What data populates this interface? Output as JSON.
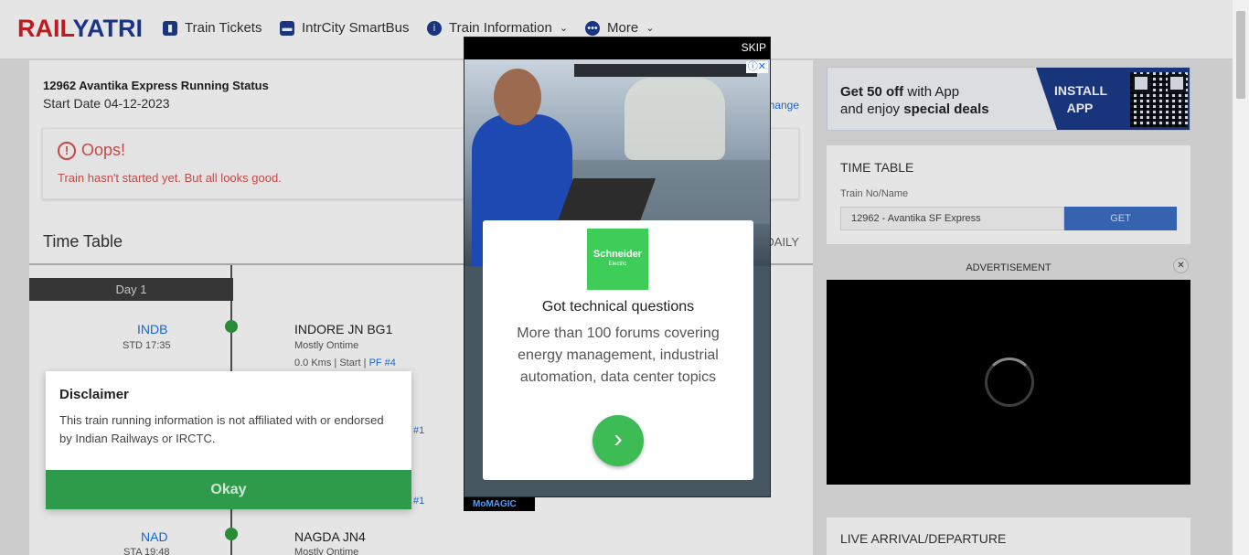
{
  "header": {
    "logo_rail": "RAIL",
    "logo_yatri": "YATRI",
    "nav": [
      {
        "label": "Train Tickets",
        "icon": "train-icon"
      },
      {
        "label": "IntrCity SmartBus",
        "icon": "bus-icon"
      },
      {
        "label": "Train Information",
        "icon": "info-icon"
      },
      {
        "label": "More",
        "icon": "more-icon"
      }
    ]
  },
  "status": {
    "title": "12962 Avantika Express Running Status",
    "start_date": "Start Date 04-12-2023",
    "change_link": "hange"
  },
  "oops": {
    "icon_glyph": "!",
    "title": "Oops!",
    "message": "Train hasn't started yet. But all looks good."
  },
  "timetable": {
    "title": "Time Table",
    "frequency": "DAILY",
    "day": "Day 1",
    "stations": [
      {
        "code": "INDB",
        "time": "STD 17:35",
        "name": "INDORE JN BG1",
        "sub": "Mostly Ontime",
        "kms": "0.0 Kms",
        "stop": "Start",
        "pf": "PF #4"
      },
      {
        "code": "NAD",
        "time": "STA 19:48",
        "name": "NAGDA JN4",
        "sub": "Mostly Ontime"
      }
    ],
    "hidden_pf_1": "#1",
    "hidden_pf_2": "#1"
  },
  "disclaimer": {
    "title": "Disclaimer",
    "text": "This train running information is not affiliated with or endorsed by Indian Railways or IRCTC.",
    "button": "Okay"
  },
  "promo": {
    "line1_pre": "Get 50 off",
    "line1_post": " with App",
    "line2_pre": "and enjoy ",
    "line2_bold": "special deals",
    "install": "INSTALL APP"
  },
  "tt_card": {
    "title": "TIME TABLE",
    "label": "Train No/Name",
    "input_value": "12962 - Avantika SF Express",
    "button": "GET"
  },
  "advertisement": {
    "label": "ADVERTISEMENT",
    "close": "✕"
  },
  "live": {
    "title": "LIVE ARRIVAL/DEPARTURE"
  },
  "ad_modal": {
    "skip": "SKIP",
    "badge": "ⓘ✕",
    "brand": "Schneider",
    "brand_sub": "Electric",
    "headline": "Got technical questions",
    "body": "More than 100 forums covering energy management, industrial automation, data center topics",
    "cta": "›",
    "network": "MoMAGIC"
  }
}
